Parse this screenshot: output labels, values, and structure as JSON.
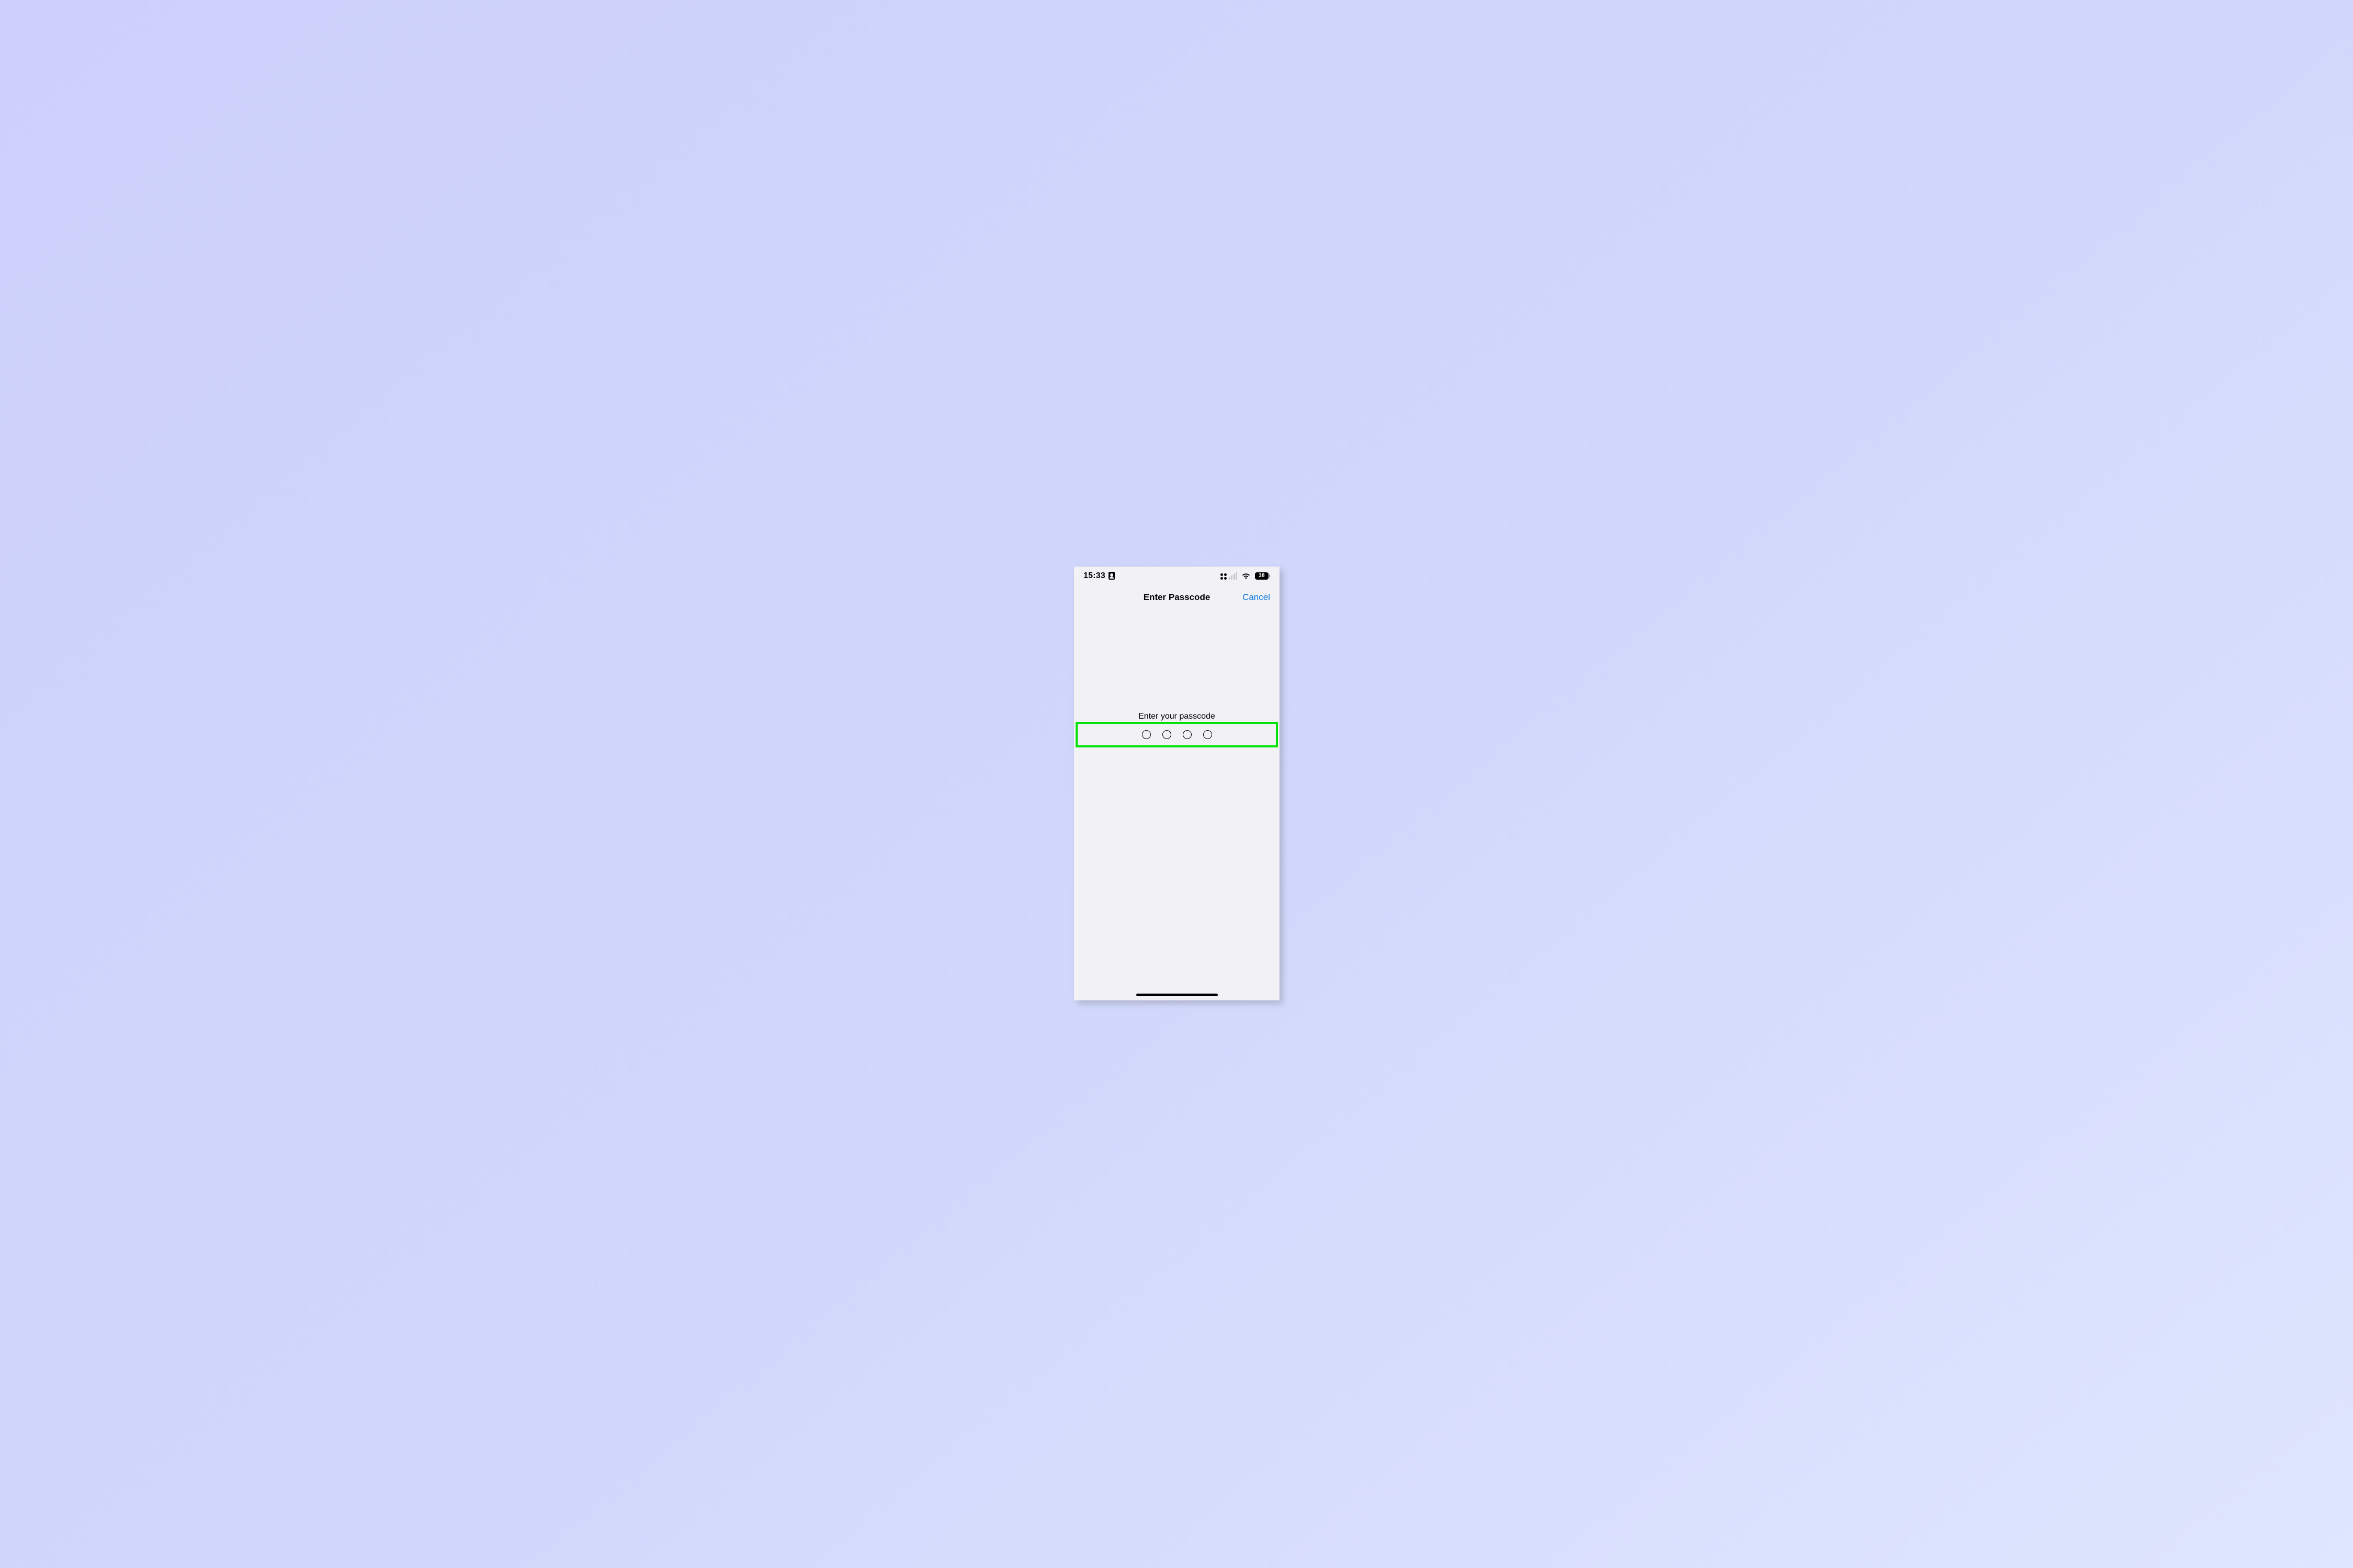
{
  "statusBar": {
    "time": "15:33",
    "batteryPercent": "38"
  },
  "nav": {
    "title": "Enter Passcode",
    "cancel": "Cancel"
  },
  "body": {
    "prompt": "Enter your passcode",
    "passcodeLength": 4,
    "filled": 0
  },
  "highlight": {
    "color": "#00e20a"
  }
}
